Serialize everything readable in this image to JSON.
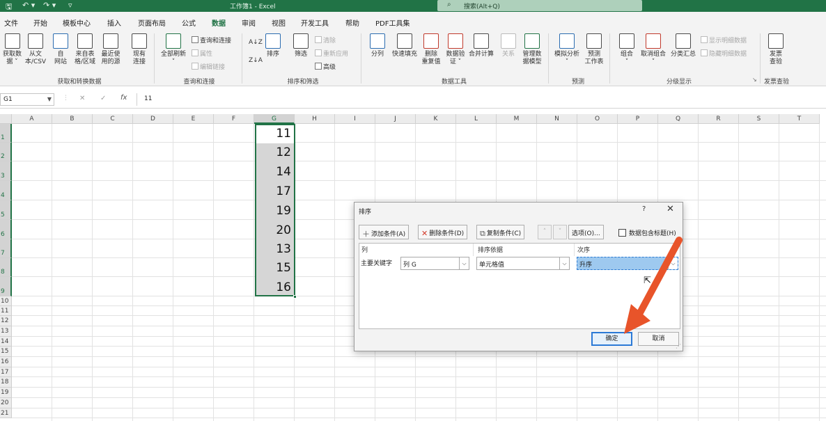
{
  "titlebar": {
    "title": "工作簿1 - Excel",
    "search_placeholder": "搜索(Alt+Q)",
    "qa_save": "🖫",
    "qa_undo": "↶ ▾",
    "qa_redo": "↷ ▾",
    "qa_custom": "▿"
  },
  "menu": {
    "file": "文件",
    "home": "开始",
    "template": "模板中心",
    "insert": "插入",
    "layout": "页面布局",
    "formula": "公式",
    "data": "数据",
    "review": "审阅",
    "view": "视图",
    "developer": "开发工具",
    "help": "帮助",
    "pdf": "PDF工具集"
  },
  "ribbon": {
    "get_data": "获取数\n据 ˅",
    "from_text": "从文\n本/CSV",
    "from_web": "自\n网站",
    "from_table": "来自表\n格/区域",
    "recent": "最近使\n用的源",
    "existing": "现有\n连接",
    "group_get": "获取和转换数据",
    "refresh_all": "全部刷新\n˅",
    "queries": "查询和连接",
    "properties": "属性",
    "edit_links": "编辑链接",
    "group_queries": "查询和连接",
    "sort_az": "A↓Z",
    "sort_za": "Z↓A",
    "sort": "排序",
    "filter": "筛选",
    "clear": "清除",
    "reapply": "重新应用",
    "advanced": "高级",
    "group_sort": "排序和筛选",
    "split": "分列",
    "flash_fill": "快速填充",
    "remove_dup": "删除\n重复值",
    "validation": "数据验\n证 ˅",
    "consolidate": "合并计算",
    "relations": "关系",
    "manage_model": "管理数\n据模型",
    "group_tools": "数据工具",
    "whatif": "模拟分析\n˅",
    "forecast": "预测\n工作表",
    "group_forecast": "预测",
    "group": "组合\n˅",
    "ungroup": "取消组合\n˅",
    "subtotal": "分类汇总",
    "show_detail": "显示明细数据",
    "hide_detail": "隐藏明细数据",
    "group_outline": "分级显示",
    "invoice": "发票\n查验",
    "group_invoice": "发票查验"
  },
  "formula_bar": {
    "name_box": "G1",
    "cancel": "✕",
    "enter": "✓",
    "fx": "fx",
    "content": "11"
  },
  "sheet": {
    "columns": [
      "A",
      "B",
      "C",
      "D",
      "E",
      "F",
      "G",
      "H",
      "I",
      "J",
      "K",
      "L",
      "M",
      "N",
      "O",
      "P",
      "Q",
      "R",
      "S",
      "T"
    ],
    "rows": [
      "1",
      "2",
      "3",
      "4",
      "5",
      "6",
      "7",
      "8",
      "9",
      "10",
      "11",
      "12",
      "13",
      "14",
      "15",
      "16",
      "17",
      "18",
      "19",
      "20",
      "21"
    ],
    "selected_column": "G",
    "g_values": [
      "11",
      "12",
      "14",
      "17",
      "19",
      "20",
      "13",
      "15",
      "16"
    ]
  },
  "dialog": {
    "title": "排序",
    "help": "?",
    "close": "✕",
    "add_level": "添加条件(A)",
    "delete_level": "删除条件(D)",
    "copy_level": "复制条件(C)",
    "move_up": "˄",
    "move_down": "˅",
    "options": "选项(O)...",
    "has_headers": "数据包含标题(H)",
    "col_header": "列",
    "sort_on_header": "排序依据",
    "order_header": "次序",
    "row_label": "主要关键字",
    "column_value": "列 G",
    "sort_on_value": "单元格值",
    "order_value": "升序",
    "ok": "确定",
    "cancel": "取消"
  },
  "colors": {
    "excel_green": "#217346",
    "arrow_orange": "#e8542a",
    "selection_blue": "#9ec9ef"
  }
}
